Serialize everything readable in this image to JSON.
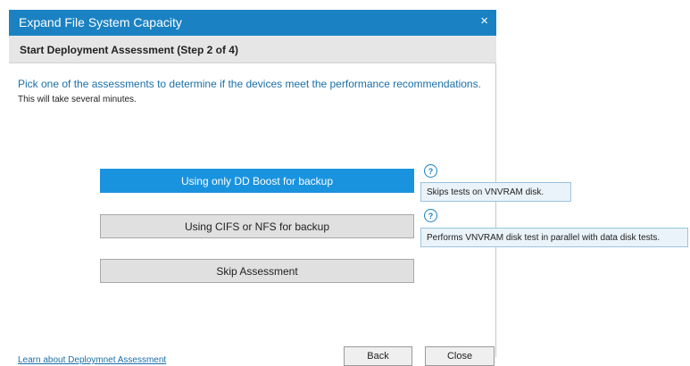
{
  "dialog": {
    "title": "Expand File System Capacity",
    "close_glyph": "×",
    "step_title": "Start Deployment Assessment (Step 2 of 4)",
    "instruction": "Pick one of the assessments to determine if the devices meet the performance recommendations.",
    "sub_instruction": "This will take several minutes."
  },
  "options": [
    {
      "label": "Using only DD Boost for backup",
      "selected": true,
      "help_glyph": "?",
      "tooltip": "Skips tests on VNVRAM disk."
    },
    {
      "label": "Using CIFS or NFS for backup",
      "selected": false,
      "help_glyph": "?",
      "tooltip": "Performs VNVRAM disk test in parallel with data disk tests."
    },
    {
      "label": "Skip Assessment",
      "selected": false
    }
  ],
  "footer": {
    "learn_link": "Learn about Deploymnet Assessment",
    "back_label": "Back",
    "close_label": "Close"
  },
  "colors": {
    "title_bar": "#1a82c3",
    "selected_option": "#1a93df",
    "link_text": "#1a6fa8",
    "tooltip_bg": "#eaf3fa"
  },
  "icons": {
    "close": "close-icon",
    "help": "help-icon"
  }
}
